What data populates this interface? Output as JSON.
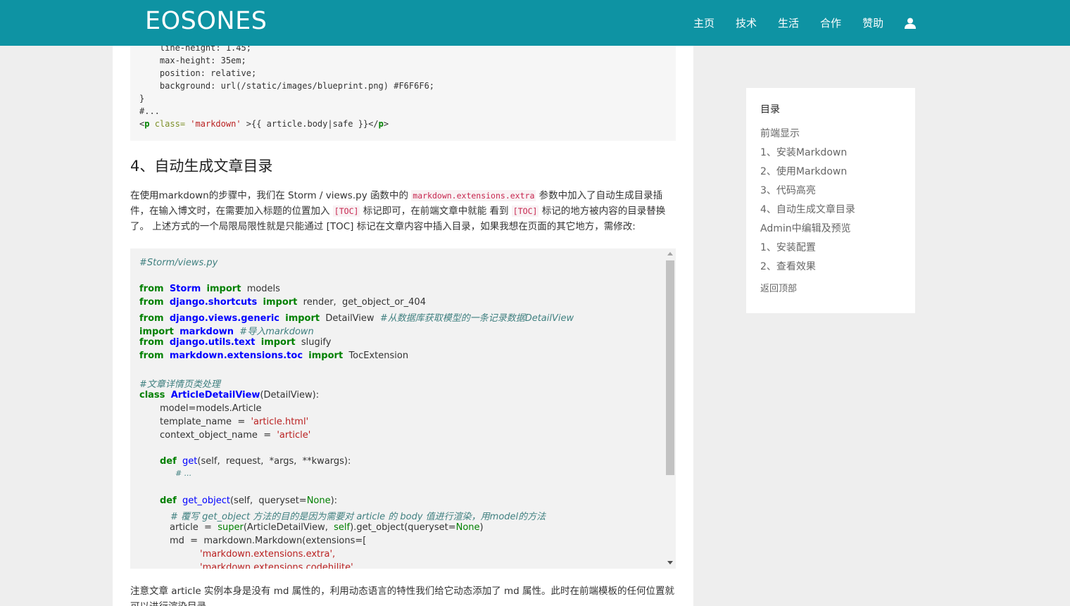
{
  "navbar": {
    "brand": "EOSONES",
    "items": [
      "主页",
      "技术",
      "生活",
      "合作",
      "赞助"
    ],
    "user_icon": "user-icon"
  },
  "code_top": {
    "lines": [
      "    line-height: 1.45;",
      "    max-height: 35em;",
      "    position: relative;",
      "    background: url(/static/images/blueprint.png) #F6F6F6;",
      "}",
      "#..."
    ],
    "last_line": {
      "open": "<",
      "tag": "p",
      "attr": "class=",
      "val": "'markdown'",
      "rest": ">{{ article.body|safe }}</",
      "close_tag": "p",
      "end": ">"
    }
  },
  "article": {
    "heading": "4、自动生成文章目录",
    "para1_a": "在使用markdown的步骤中，我们在 Storm / views.py 函数中的 ",
    "para1_code1": "markdown.extensions.extra",
    "para1_b": " 参数中加入了自动生成目录插件，在输入博文时，在需要加入标题的位置加入 ",
    "para1_code2": "[TOC]",
    "para1_c": " 标记即可，在前端文章中就能 看到 ",
    "para1_code3": "[TOC]",
    "para1_d": " 标记的地方被内容的目录替换了。 上述方式的一个局限局限性就是只能通过 [TOC] 标记在文章内容中插入目录，如果我想在页面的其它地方，需修改:",
    "para2": "注意文章 article 实例本身是没有 md 属性的，利用动态语言的特性我们给它动态添加了 md 属性。此时在前端模板的任何位置就可以进行渲染目录。"
  },
  "codeblock": {
    "l1": "#Storm/views.py",
    "l2": [
      "from",
      "Storm",
      "import",
      "models"
    ],
    "l3": [
      "from",
      "django.shortcuts",
      "import",
      "render,  get_object_or_404"
    ],
    "l4": [
      "from",
      "django.views.generic",
      "import",
      "DetailView",
      "#从数据库获取模型的一条记录数据DetailView"
    ],
    "l5": [
      "import",
      "markdown",
      "#导入markdown"
    ],
    "l6": [
      "from",
      "django.utils.text",
      "import",
      "slugify"
    ],
    "l7": [
      "from",
      "markdown.extensions.toc",
      "import",
      "TocExtension"
    ],
    "l8": "#文章详情页类处理",
    "l9": [
      "class",
      "ArticleDetailView",
      "(DetailView):"
    ],
    "l10": "model=models.Article",
    "l11": [
      "template_name  =  ",
      "'article.html'"
    ],
    "l12": [
      "context_object_name  =  ",
      "'article'"
    ],
    "l13": [
      "def",
      "get",
      "(self,  request,  *args,  **kwargs):"
    ],
    "l14": "# ...",
    "l15": [
      "def",
      "get_object",
      "(self,  queryset=",
      "None",
      "):"
    ],
    "l16": "# 覆写 get_object 方法的目的是因为需要对 article 的 body 值进行渲染，用model的方法",
    "l17": [
      "article  =  ",
      "super",
      "(ArticleDetailView,  ",
      "self",
      ").get_object(queryset=",
      "None",
      ")"
    ],
    "l18": "md  =  markdown.Markdown(extensions=[",
    "l19": "'markdown.extensions.extra',",
    "l20": "'markdown.extensions.codehilite',"
  },
  "toc": {
    "title": "目录",
    "items": [
      "前端显示",
      "1、安装Markdown",
      "2、使用Markdown",
      "3、代码高亮",
      "4、自动生成文章目录",
      "Admin中编辑及预览",
      "1、安装配置",
      "2、查看效果"
    ],
    "back_to_top": "返回顶部"
  }
}
